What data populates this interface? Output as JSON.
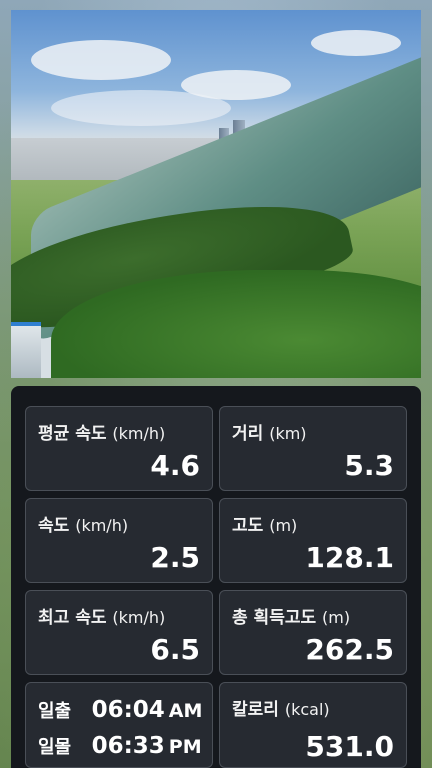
{
  "colors": {
    "panel_bg": "#15181d",
    "card_bg": "#262a31",
    "card_border": "#4a4f57",
    "text": "#ffffff"
  },
  "photo": {
    "description_icon": "landscape-photo"
  },
  "stats": {
    "avg_speed": {
      "label": "평균 속도",
      "unit": "(km/h)",
      "value": "4.6"
    },
    "distance": {
      "label": "거리",
      "unit": "(km)",
      "value": "5.3"
    },
    "speed": {
      "label": "속도",
      "unit": "(km/h)",
      "value": "2.5"
    },
    "altitude": {
      "label": "고도",
      "unit": "(m)",
      "value": "128.1"
    },
    "max_speed": {
      "label": "최고 속도",
      "unit": "(km/h)",
      "value": "6.5"
    },
    "total_gain": {
      "label": "총 획득고도",
      "unit": "(m)",
      "value": "262.5"
    },
    "calories": {
      "label": "칼로리",
      "unit": "(kcal)",
      "value": "531.0"
    }
  },
  "sun": {
    "sunrise_label": "일출",
    "sunrise_time": "06:04",
    "sunrise_ampm": "AM",
    "sunset_label": "일몰",
    "sunset_time": "06:33",
    "sunset_ampm": "PM"
  }
}
